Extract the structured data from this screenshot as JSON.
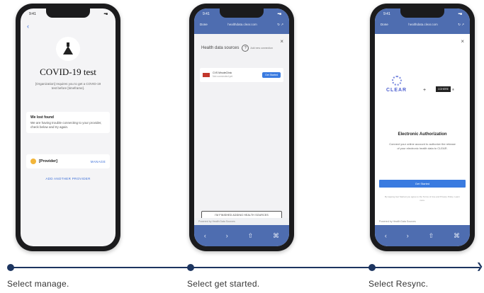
{
  "phones": [
    {
      "status": {
        "time": "9:41",
        "signal": "••• ■"
      },
      "back": "‹",
      "icon": "flask-icon",
      "title": "COVID-19 test",
      "description": "[Organization] requires you to get a COVID-19 test before [timeframe].",
      "warning": {
        "title": "We lost found",
        "body": "We are having trouble connecting to your provider, check below and try again."
      },
      "provider": {
        "name": "[Provider]",
        "action": "MANAGE"
      },
      "add_provider": "ADD ANOTHER PROVIDER"
    },
    {
      "status": {
        "time": "9:41",
        "signal": "••• ■"
      },
      "nav": {
        "left": "Done",
        "url": "healthdata.clear.com",
        "right": "↻ ↗"
      },
      "close": "×",
      "heading": "Health data sources",
      "help": "?",
      "help_link": "Add new connection",
      "org": {
        "name": "CVS MinuteClinic",
        "sub": "Not connected yet",
        "button": "Get Started"
      },
      "bottom_button": "I'M FINISHED ADDING HEALTH SOURCES",
      "hds_label": "Powered by Health Data Sources",
      "toolbar": [
        "‹",
        "›",
        "⇧",
        "⌘"
      ]
    },
    {
      "status": {
        "time": "9:41",
        "signal": "••• ■"
      },
      "nav": {
        "left": "Done",
        "url": "healthdata.clear.com",
        "right": "↻ ↗"
      },
      "close": "×",
      "clear_logo": "CLEAR",
      "plus": "+",
      "cohere": {
        "box": "COHERE",
        "suffix": "®"
      },
      "ea_title": "Electronic Authorization",
      "ea_body": "Connect your online account to authorize the release of your electronic health data to CLEAR.",
      "get_started": "Get Started",
      "fine_print": "By tapping Get Started you agree to the Terms of Use and Privacy Policy. Learn more.",
      "hds_label": "Powered by Health Data Sources",
      "toolbar": [
        "‹",
        "›",
        "⇧",
        "⌘"
      ]
    }
  ],
  "captions": [
    "Select manage.",
    "Select get started.",
    "Select Resync."
  ],
  "colors": {
    "timeline": "#1d3560",
    "accent": "#3a7be0",
    "browser_bar": "#4e6db0"
  }
}
